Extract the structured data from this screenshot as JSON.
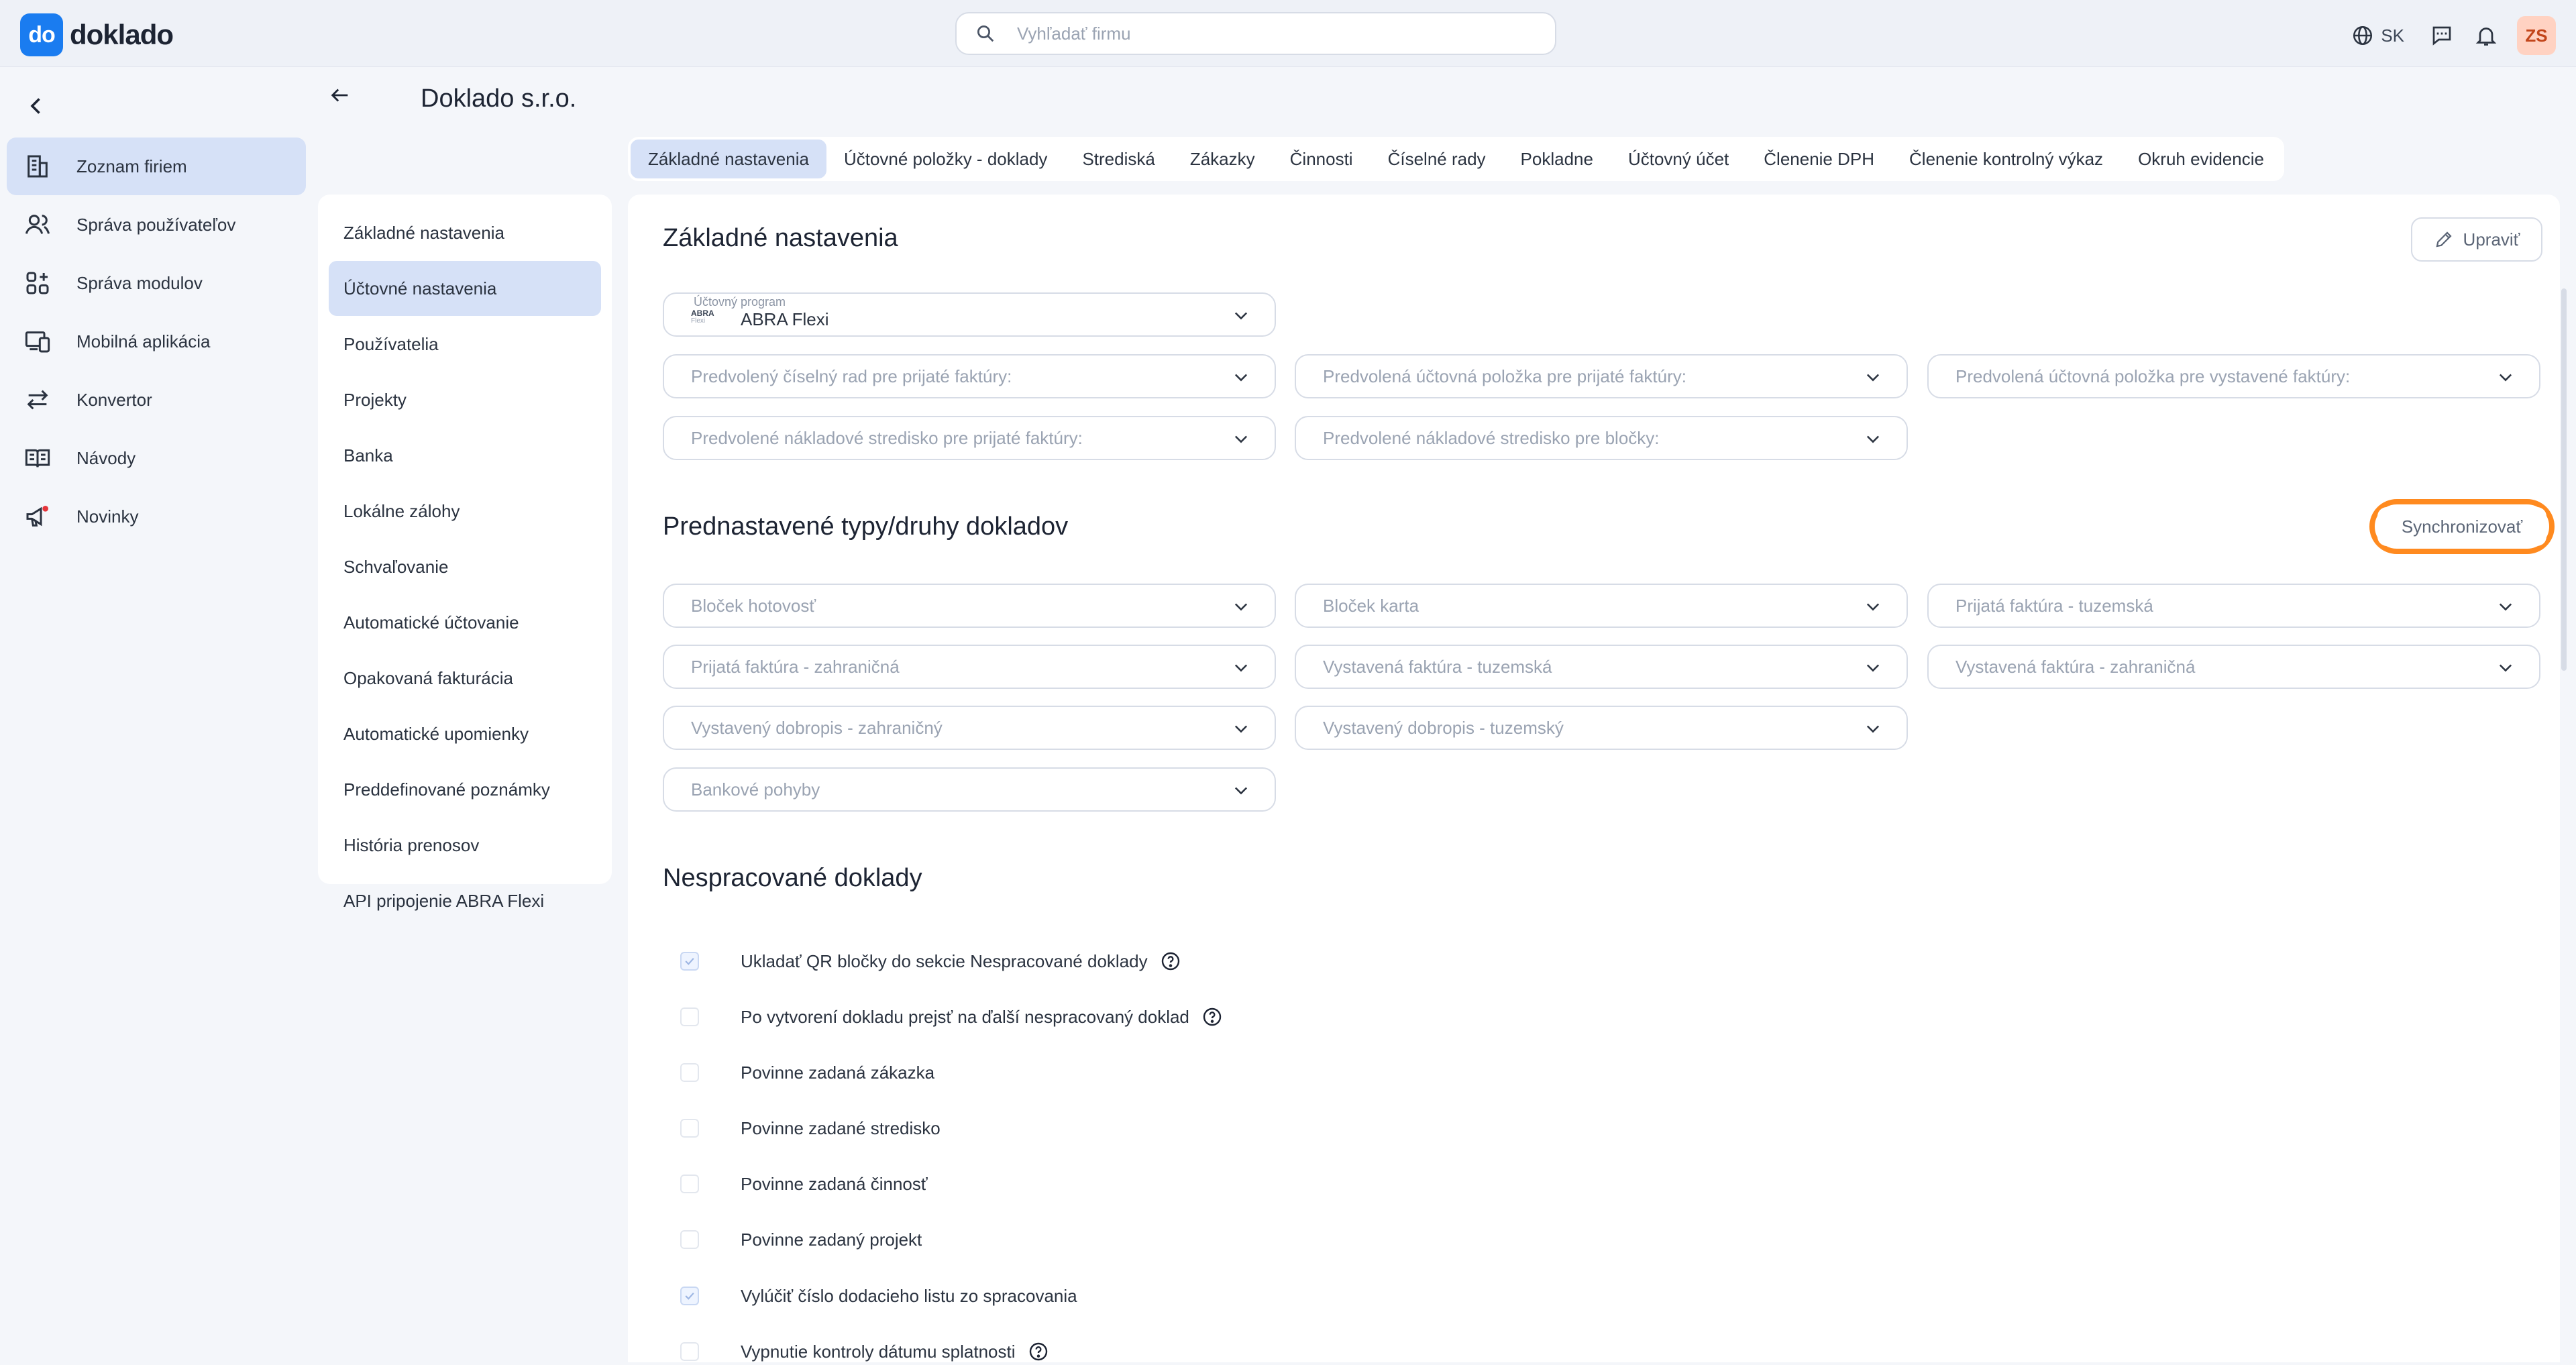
{
  "app": {
    "logo_mark": "do",
    "logo_text": "doklado"
  },
  "search": {
    "placeholder": "Vyhľadať firmu"
  },
  "topbar": {
    "language": "SK",
    "avatar_initials": "ZS"
  },
  "sidebar": {
    "items": [
      {
        "label": "Zoznam firiem",
        "icon": "building-icon",
        "active": true
      },
      {
        "label": "Správa používateľov",
        "icon": "users-icon",
        "active": false
      },
      {
        "label": "Správa modulov",
        "icon": "modules-icon",
        "active": false
      },
      {
        "label": "Mobilná aplikácia",
        "icon": "mobile-icon",
        "active": false
      },
      {
        "label": "Konvertor",
        "icon": "convert-icon",
        "active": false
      },
      {
        "label": "Návody",
        "icon": "book-icon",
        "active": false
      },
      {
        "label": "Novinky",
        "icon": "megaphone-icon",
        "active": false
      }
    ]
  },
  "company": {
    "title": "Doklado s.r.o."
  },
  "submenu": {
    "items": [
      {
        "label": "Základné nastavenia",
        "active": false
      },
      {
        "label": "Účtovné nastavenia",
        "active": true
      },
      {
        "label": "Používatelia",
        "active": false
      },
      {
        "label": "Projekty",
        "active": false
      },
      {
        "label": "Banka",
        "active": false
      },
      {
        "label": "Lokálne zálohy",
        "active": false
      },
      {
        "label": "Schvaľovanie",
        "active": false
      },
      {
        "label": "Automatické účtovanie",
        "active": false
      },
      {
        "label": "Opakovaná fakturácia",
        "active": false
      },
      {
        "label": "Automatické upomienky",
        "active": false
      },
      {
        "label": "Preddefinované poznámky",
        "active": false
      },
      {
        "label": "História prenosov",
        "active": false
      },
      {
        "label": "API pripojenie ABRA Flexi",
        "active": false
      }
    ]
  },
  "tabs": [
    {
      "label": "Základné nastavenia",
      "active": true
    },
    {
      "label": "Účtovné položky - doklady",
      "active": false
    },
    {
      "label": "Strediská",
      "active": false
    },
    {
      "label": "Zákazky",
      "active": false
    },
    {
      "label": "Činnosti",
      "active": false
    },
    {
      "label": "Číselné rady",
      "active": false
    },
    {
      "label": "Pokladne",
      "active": false
    },
    {
      "label": "Účtovný účet",
      "active": false
    },
    {
      "label": "Členenie DPH",
      "active": false
    },
    {
      "label": "Členenie kontrolný výkaz",
      "active": false
    },
    {
      "label": "Okruh evidencie",
      "active": false
    }
  ],
  "basic": {
    "title": "Základné nastavenia",
    "edit_label": "Upraviť",
    "program_label": "Účtovný program",
    "program_value": "ABRA Flexi",
    "program_logo_top": "ABRA",
    "program_logo_bottom": "Flexi",
    "selects": [
      "Predvolený číselný rad pre prijaté faktúry:",
      "Predvolená účtovná položka pre prijaté faktúry:",
      "Predvolená účtovná položka pre vystavené faktúry:",
      "Predvolené nákladové stredisko pre prijaté faktúry:",
      "Predvolené nákladové stredisko pre bločky:"
    ]
  },
  "doc_types": {
    "title": "Prednastavené typy/druhy dokladov",
    "sync_label": "Synchronizovať",
    "selects": [
      "Bloček hotovosť",
      "Bloček karta",
      "Prijatá faktúra - tuzemská",
      "Prijatá faktúra - zahraničná",
      "Vystavená faktúra - tuzemská",
      "Vystavená faktúra - zahraničná",
      "Vystavený dobropis - zahraničný",
      "Vystavený dobropis - tuzemský",
      "Bankové pohyby"
    ]
  },
  "unprocessed": {
    "title": "Nespracované doklady",
    "options": [
      {
        "label": "Ukladať QR bločky do sekcie Nespracované doklady",
        "checked": true,
        "help": true
      },
      {
        "label": "Po vytvorení dokladu prejsť na ďalší nespracovaný doklad",
        "checked": false,
        "help": true
      },
      {
        "label": "Povinne zadaná zákazka",
        "checked": false,
        "help": false
      },
      {
        "label": "Povinne zadané stredisko",
        "checked": false,
        "help": false
      },
      {
        "label": "Povinne zadaná činnosť",
        "checked": false,
        "help": false
      },
      {
        "label": "Povinne zadaný projekt",
        "checked": false,
        "help": false
      },
      {
        "label": "Vylúčiť číslo dodacieho listu zo spracovania",
        "checked": true,
        "help": false
      },
      {
        "label": "Vypnutie kontroly dátumu splatnosti",
        "checked": false,
        "help": true
      }
    ]
  },
  "colors": {
    "accent": "#1a7cf0",
    "active_bg": "#d6e1f7",
    "highlight_ring": "#ff8a1f"
  }
}
